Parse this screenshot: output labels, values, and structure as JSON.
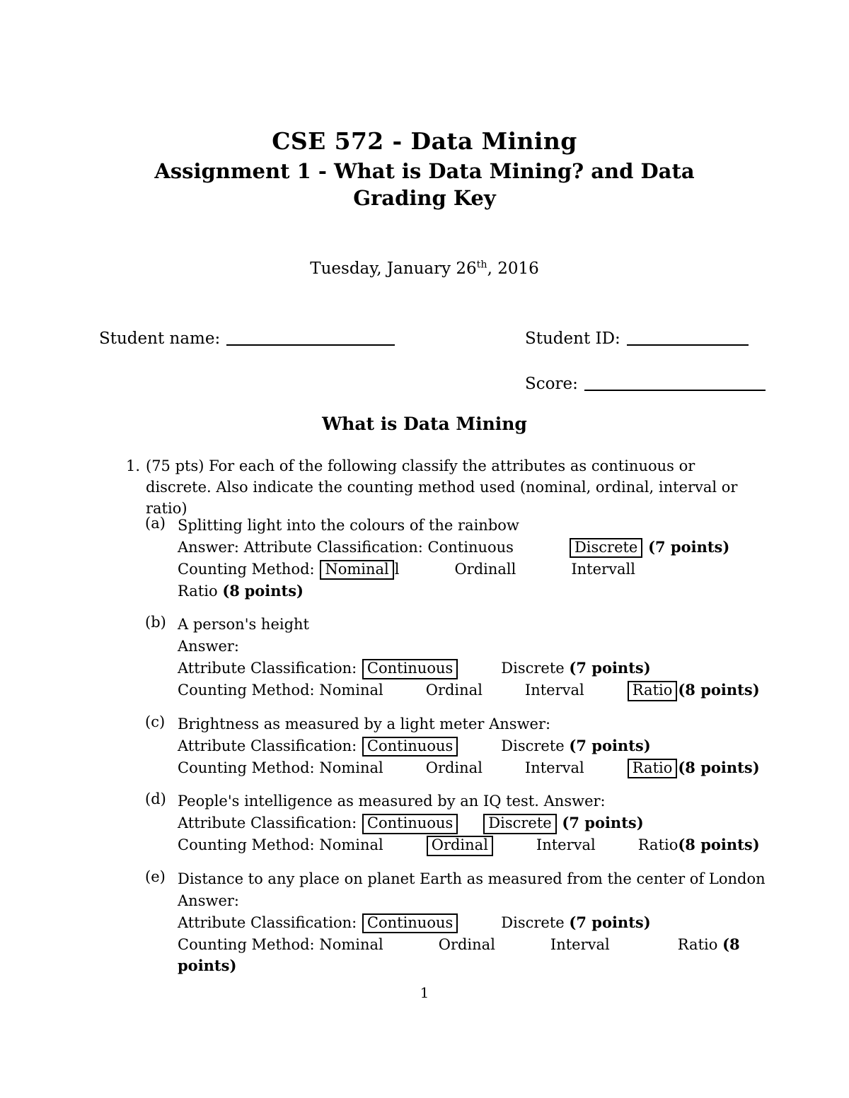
{
  "document": {
    "course_title": "CSE 572 - Data Mining",
    "assignment_title_line1": "Assignment 1 - What is Data Mining? and Data",
    "assignment_title_line2": "Grading Key",
    "date_prefix": "Tuesday, January 26",
    "date_superscript": "th",
    "date_suffix": ", 2016",
    "page_number": "1"
  },
  "student_fields": {
    "name_label": "Student name:",
    "id_label": "Student ID:",
    "score_label": "Score:"
  },
  "section": {
    "heading": "What is Data Mining"
  },
  "question1": {
    "number": "1.",
    "text": "(75 pts) For each of the following classify the attributes as continuous or discrete. Also indicate the counting method used (nominal, ordinal, interval or ratio)",
    "labels": {
      "answer": "Answer:",
      "attribute_classification": "Attribute Classification:",
      "counting_method": "Counting Method:",
      "continuous": "Continuous",
      "discrete": "Discrete",
      "nominal": "Nominal",
      "ordinal": "Ordinal",
      "interval": "Interval",
      "ratio": "Ratio",
      "points_7": "(7 points)",
      "points_8": "(8 points)",
      "points_8_open": "(8",
      "points_8_close": "points)",
      "artifact_l": "l"
    },
    "items": [
      {
        "label": "(a)",
        "prompt": "Splitting light into the colours of the rainbow",
        "answer_inline_prefix": "Answer: Attribute Classification:",
        "classification_answer": "Discrete",
        "counting_answer": "Nominal"
      },
      {
        "label": "(b)",
        "prompt": "A person's height",
        "classification_answer": "Continuous",
        "counting_answer": "Ratio"
      },
      {
        "label": "(c)",
        "prompt": "Brightness as measured by a light meter Answer:",
        "classification_answer": "Continuous",
        "counting_answer": "Ratio"
      },
      {
        "label": "(d)",
        "prompt": "People's intelligence as measured by an IQ test. Answer:",
        "classification_answer": "Continuous and Discrete",
        "counting_answer": "Ordinal"
      },
      {
        "label": "(e)",
        "prompt": "Distance to any place on planet Earth as measured from the center of London",
        "classification_answer": "Continuous",
        "counting_answer": "none"
      }
    ]
  }
}
